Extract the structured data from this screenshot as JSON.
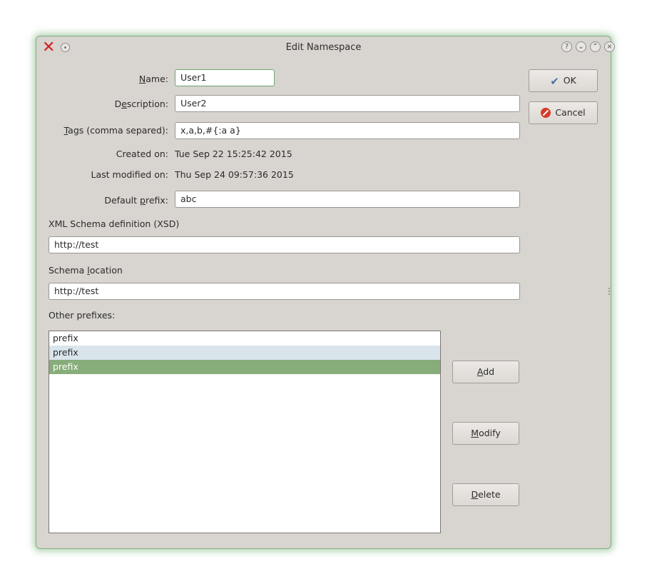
{
  "window": {
    "title": "Edit Namespace"
  },
  "form": {
    "name": {
      "label_u": "N",
      "label_rest": "ame:",
      "value": "User1"
    },
    "description": {
      "label_a": "D",
      "label_u": "e",
      "label_rest": "scription:",
      "value": "User2"
    },
    "tags": {
      "label_u": "T",
      "label_rest": "ags (comma separed):",
      "value": "x,a,b,#{:a a}"
    },
    "created": {
      "label": "Created on:",
      "value": "Tue Sep 22 15:25:42 2015"
    },
    "modified": {
      "label": "Last modified on:",
      "value": "Thu Sep 24 09:57:36 2015"
    },
    "default_prefix": {
      "label_a": "Default ",
      "label_u": "p",
      "label_rest": "refix:",
      "value": "abc"
    },
    "xsd": {
      "label": "XML Schema definition (XSD)",
      "value": "http://test"
    },
    "schema_location": {
      "label_a": "Schema ",
      "label_u": "l",
      "label_rest": "ocation",
      "value": "http://test"
    },
    "other_prefixes": {
      "label": "Other prefixes:",
      "items": [
        "prefix",
        "prefix",
        "prefix"
      ],
      "selected_index": 2
    }
  },
  "buttons": {
    "ok": "OK",
    "cancel": "Cancel",
    "add_u": "A",
    "add_rest": "dd",
    "modify_u": "M",
    "modify_rest": "odify",
    "delete_u": "D",
    "delete_rest": "elete"
  },
  "icons": {
    "close": "close-x-icon",
    "ok": "checkmark-icon",
    "cancel": "no-entry-icon"
  },
  "colors": {
    "accent": "#86ad7a",
    "alt_row": "#d9e5eb",
    "close_x": "#d42020"
  }
}
